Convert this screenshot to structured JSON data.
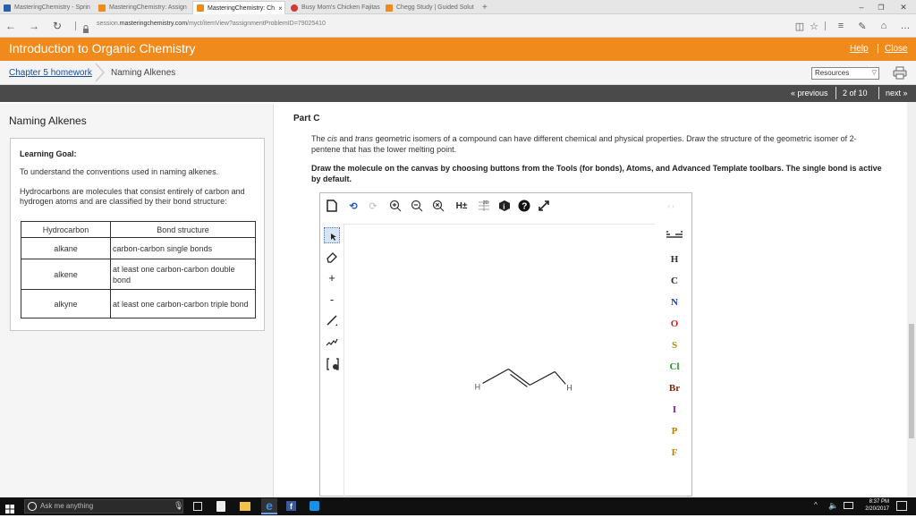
{
  "browser": {
    "tabs": [
      {
        "label": "MasteringChemistry - Sprin",
        "color": "#2b5fa8",
        "active": false
      },
      {
        "label": "MasteringChemistry: Assign",
        "color": "#f08a1c",
        "active": false
      },
      {
        "label": "MasteringChemistry: Ch",
        "color": "#f08a1c",
        "active": true
      },
      {
        "label": "Busy Mom's Chicken Fajitas",
        "color": "#d23a3a",
        "active": false
      },
      {
        "label": "Chegg Study | Guided Solut",
        "color": "#f08a1c",
        "active": false
      }
    ],
    "new_tab": "+",
    "close_tab": "×",
    "url_prefix": "session.",
    "url_host": "masteringchemistry.com",
    "url_path": "/myct/itemView?assignmentProblemID=79025410"
  },
  "header": {
    "title": "Introduction to Organic Chemistry",
    "help": "Help",
    "separator": "|",
    "close": "Close"
  },
  "breadcrumb": {
    "chapter": "Chapter 5 homework",
    "current": "Naming Alkenes",
    "resources": "Resources"
  },
  "nav": {
    "previous": "« previous",
    "page": "2 of 10",
    "next": "next »"
  },
  "left": {
    "title": "Naming Alkenes",
    "goal_label": "Learning Goal:",
    "goal_text": "To understand the conventions used in naming alkenes.",
    "hydro_text": "Hydrocarbons are molecules that consist entirely of carbon and hydrogen atoms and are classified by their bond structure:",
    "table": {
      "headers": [
        "Hydrocarbon",
        "Bond structure"
      ],
      "rows": [
        [
          "alkane",
          "carbon-carbon single bonds"
        ],
        [
          "alkene",
          "at least one carbon-carbon double bond"
        ],
        [
          "alkyne",
          "at least one carbon-carbon triple bond"
        ]
      ]
    }
  },
  "question": {
    "part": "Part C",
    "text_1": "The ",
    "cis": "cis",
    "text_2": " and ",
    "trans": "trans",
    "text_3": " geometric isomers of a compound can have different chemical and physical properties. Draw the structure of the geometric isomer of 2-pentene that has the lower melting point.",
    "instruction": "Draw the molecule on the canvas by choosing buttons from the Tools (for bonds), Atoms, and Advanced Template toolbars. The single bond is active by default."
  },
  "editor": {
    "h_label": "H±",
    "atoms": [
      {
        "symbol": "H",
        "color": "#333333"
      },
      {
        "symbol": "C",
        "color": "#222222"
      },
      {
        "symbol": "N",
        "color": "#1f3fbf"
      },
      {
        "symbol": "O",
        "color": "#d41f1f"
      },
      {
        "symbol": "S",
        "color": "#b8860b"
      },
      {
        "symbol": "Cl",
        "color": "#1f9a1f"
      },
      {
        "symbol": "Br",
        "color": "#8b2500"
      },
      {
        "symbol": "I",
        "color": "#7a1fa0"
      },
      {
        "symbol": "P",
        "color": "#c87a00"
      },
      {
        "symbol": "F",
        "color": "#b8860b"
      }
    ],
    "molecule_labels": [
      "H",
      "H"
    ],
    "plus": "+",
    "minus": "-"
  },
  "taskbar": {
    "search_placeholder": "Ask me anything",
    "time": "8:37 PM",
    "date": "2/20/2017"
  }
}
